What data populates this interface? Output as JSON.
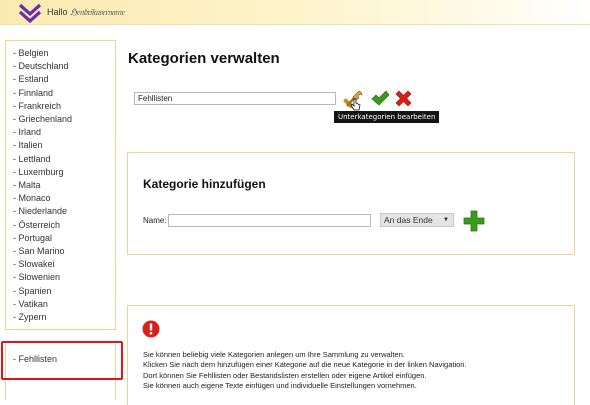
{
  "header": {
    "greeting": "Hallo",
    "user_name": "ℌ𝔢𝔫𝔡𝔯𝔦𝔨𝔲𝔰𝔢𝔯𝔫𝔞𝔪𝔢",
    "accent_color": "#6a2fa8"
  },
  "sidebar": {
    "countries": [
      "- Belgien",
      "- Deutschland",
      "- Estland",
      "- Finnland",
      "- Frankreich",
      "- Griechenland",
      "- Irland",
      "- Italien",
      "- Lettland",
      "- Luxemburg",
      "- Malta",
      "- Monaco",
      "- Niederlande",
      "- Österreich",
      "- Portugal",
      "- San Marino",
      "- Slowakei",
      "- Slowenien",
      "- Spanien",
      "- Vatikan",
      "- Zypern"
    ],
    "lists_item": "- Fehllisten",
    "highlight_color": "#e0141a"
  },
  "main": {
    "title": "Kategorien verwalten",
    "category_value": "Fehllisten",
    "edit_icon": "wrench-icon",
    "confirm_icon": "checkmark-icon",
    "delete_icon": "cross-icon",
    "tooltip": "Unterkategorien bearbeiten"
  },
  "add_section": {
    "title": "Kategorie hinzufügen",
    "name_label": "Name:",
    "name_value": "",
    "position_select": "An das Ende",
    "add_icon": "plus-icon"
  },
  "info": {
    "icon": "error-icon",
    "lines": [
      "Sie können beliebig viele Kategorien anlegen um Ihre Sammlung zu verwalten.",
      "Klicken Sie nach dem hinzufügen einer Kategorie auf die neue Kategorie in der linken Navigation.",
      "Dort können Sie Fehllisten oder Bestandslisten erstellen oder eigene Artikel einfügen.",
      "Sie können auch eigene Texte einfügen und individuelle Einstellungen vornehmen."
    ]
  }
}
